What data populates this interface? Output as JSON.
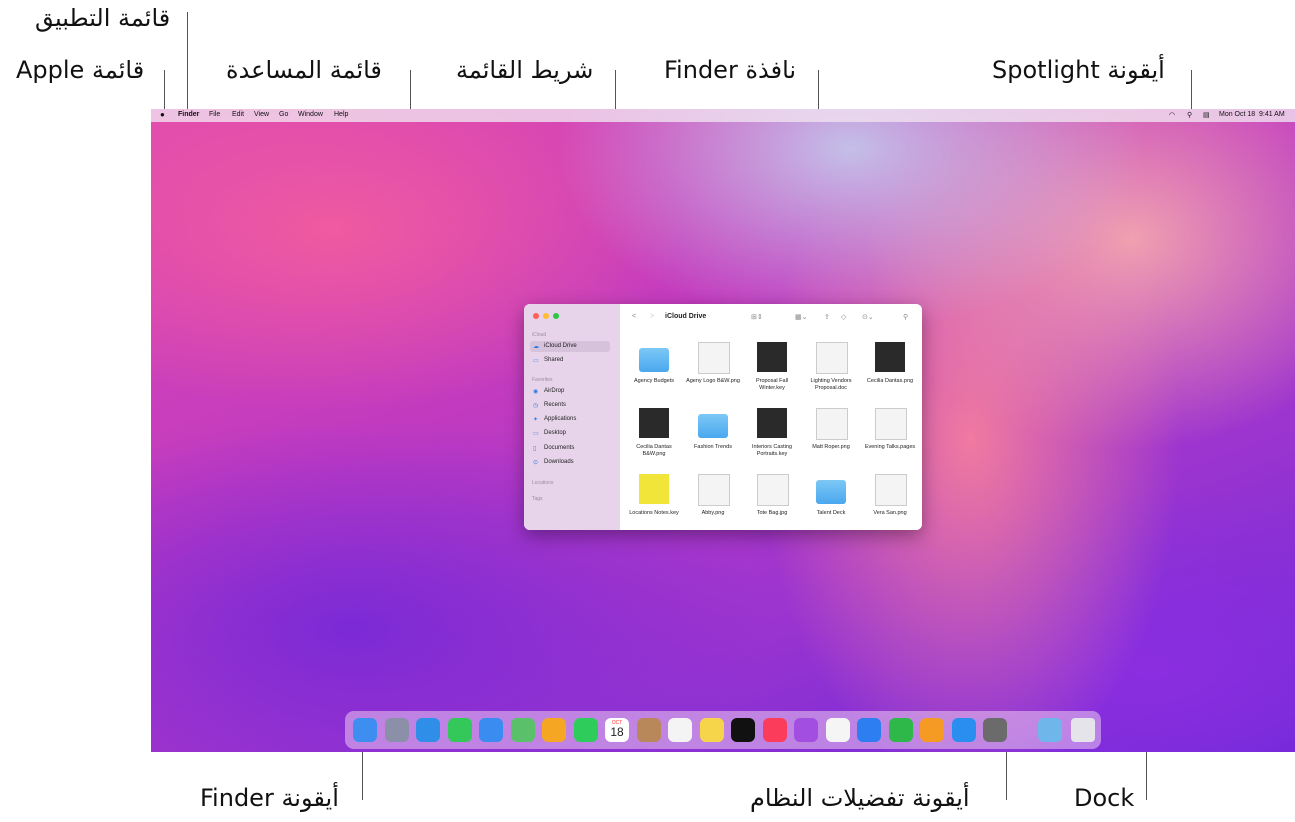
{
  "callouts": {
    "app_menu": "قائمة التطبيق",
    "apple_menu": "قائمة Apple",
    "help_menu": "قائمة المساعدة",
    "menu_bar": "شريط القائمة",
    "finder_window": "نافذة Finder",
    "spotlight_icon": "أيقونة Spotlight",
    "finder_icon": "أيقونة Finder",
    "system_prefs_icon": "أيقونة تفضيلات النظام",
    "dock": "Dock"
  },
  "menubar": {
    "apple": "",
    "app": "Finder",
    "items": [
      "File",
      "Edit",
      "View",
      "Go",
      "Window",
      "Help"
    ],
    "date": "Mon Oct 18",
    "time": "9:41 AM"
  },
  "finder": {
    "title": "iCloud Drive",
    "sidebar": {
      "icloud_header": "iCloud",
      "icloud_items": [
        "iCloud Drive",
        "Shared"
      ],
      "favorites_header": "Favorites",
      "favorites": [
        "AirDrop",
        "Recents",
        "Applications",
        "Desktop",
        "Documents",
        "Downloads"
      ],
      "locations_header": "Locations",
      "tags_header": "Tags"
    },
    "files": [
      {
        "name": "Agency Budgets",
        "kind": "folder"
      },
      {
        "name": "Ageny Logo B&W.png",
        "kind": "doc"
      },
      {
        "name": "Proposal Fall Winter.key",
        "kind": "dark"
      },
      {
        "name": "Lighting Vendors Proposal.doc",
        "kind": "doc"
      },
      {
        "name": "Cecilia Dantas.png",
        "kind": "dark"
      },
      {
        "name": "Cecilia Dantas B&W.png",
        "kind": "dark"
      },
      {
        "name": "Fashion Trends",
        "kind": "folder"
      },
      {
        "name": "Interiors Casting Portraits.key",
        "kind": "dark"
      },
      {
        "name": "Matt Roper.png",
        "kind": "doc"
      },
      {
        "name": "Evening Talks.pages",
        "kind": "doc"
      },
      {
        "name": "Locations Notes.key",
        "kind": "yellow"
      },
      {
        "name": "Abby.png",
        "kind": "doc"
      },
      {
        "name": "Tote Bag.jpg",
        "kind": "doc"
      },
      {
        "name": "Talent Deck",
        "kind": "folder"
      },
      {
        "name": "Vera San.png",
        "kind": "doc"
      }
    ]
  },
  "dock": {
    "calendar_month": "OCT",
    "calendar_day": "18",
    "apps": [
      {
        "name": "Finder",
        "color": "#3d8ef0"
      },
      {
        "name": "Launchpad",
        "color": "#8b8fa8"
      },
      {
        "name": "Safari",
        "color": "#2f8fe8"
      },
      {
        "name": "Messages",
        "color": "#34c759"
      },
      {
        "name": "Mail",
        "color": "#3a8cf0"
      },
      {
        "name": "Maps",
        "color": "#5ac06a"
      },
      {
        "name": "Photos",
        "color": "#f5a623"
      },
      {
        "name": "FaceTime",
        "color": "#2ecc5a"
      },
      {
        "name": "Calendar",
        "color": "#ffffff"
      },
      {
        "name": "Contacts",
        "color": "#b8875a"
      },
      {
        "name": "Reminders",
        "color": "#f4f4f4"
      },
      {
        "name": "Notes",
        "color": "#f7d54a"
      },
      {
        "name": "TV",
        "color": "#111111"
      },
      {
        "name": "Music",
        "color": "#fb3c5a"
      },
      {
        "name": "Podcasts",
        "color": "#a24ee0"
      },
      {
        "name": "News",
        "color": "#f5f5f5"
      },
      {
        "name": "Keynote",
        "color": "#2d7ef0"
      },
      {
        "name": "Numbers",
        "color": "#2fb84a"
      },
      {
        "name": "Pages",
        "color": "#f59a23"
      },
      {
        "name": "App Store",
        "color": "#2a8ef0"
      },
      {
        "name": "System Preferences",
        "color": "#6b6b6b"
      }
    ]
  }
}
